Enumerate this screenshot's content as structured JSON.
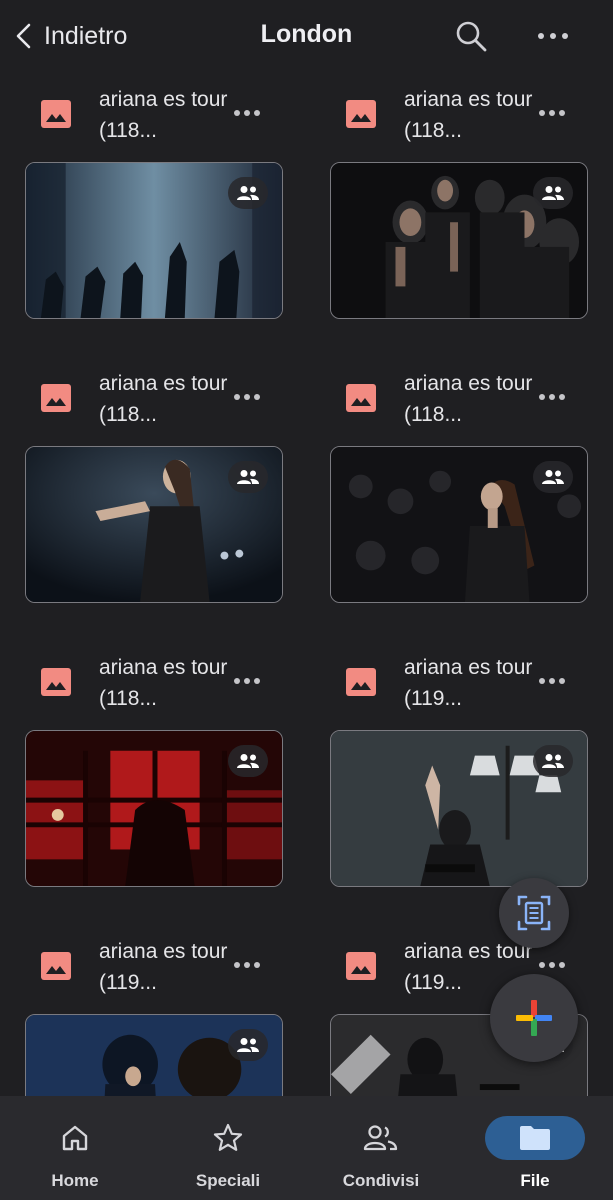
{
  "header": {
    "back_label": "Indietro",
    "title": "London",
    "search_icon": "search-icon",
    "more_icon": "more-horizontal-icon"
  },
  "files": [
    {
      "name": "ariana es tour (118...",
      "shared": true
    },
    {
      "name": "ariana es tour (118...",
      "shared": true
    },
    {
      "name": "ariana es tour (118...",
      "shared": true
    },
    {
      "name": "ariana es tour (118...",
      "shared": true
    },
    {
      "name": "ariana es tour (118...",
      "shared": true
    },
    {
      "name": "ariana es tour (119...",
      "shared": true
    },
    {
      "name": "ariana es tour (119...",
      "shared": true
    },
    {
      "name": "ariana es tour (119...",
      "shared": true
    }
  ],
  "fab": {
    "scan_icon": "document-scan-icon",
    "new_icon": "plus-icon"
  },
  "nav": {
    "items": [
      {
        "label": "Home",
        "icon": "home-icon",
        "active": false
      },
      {
        "label": "Speciali",
        "icon": "star-icon",
        "active": false
      },
      {
        "label": "Condivisi",
        "icon": "people-icon",
        "active": false
      },
      {
        "label": "File",
        "icon": "folder-icon",
        "active": true
      }
    ]
  },
  "colors": {
    "background": "#1f1f22",
    "file_icon": "#f28b82",
    "active_nav": "#2d5f94",
    "plus_blue": "#4285f4",
    "plus_red": "#ea4335",
    "plus_yellow": "#fbbc04",
    "plus_green": "#34a853"
  }
}
